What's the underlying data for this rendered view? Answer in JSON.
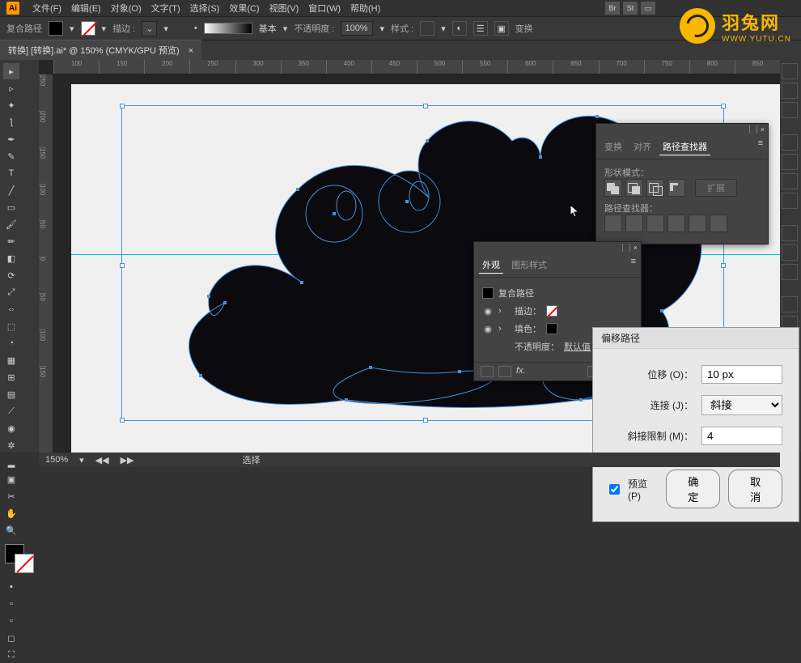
{
  "menu": {
    "items": [
      "文件(F)",
      "编辑(E)",
      "对象(O)",
      "文字(T)",
      "选择(S)",
      "效果(C)",
      "视图(V)",
      "窗口(W)",
      "帮助(H)"
    ],
    "right_icons": [
      "Br",
      "St"
    ]
  },
  "controlbar": {
    "label": "复合路径",
    "stroke_label": "描边 :",
    "stroke_dropdown": "",
    "preset_label": "基本",
    "opacity_label": "不透明度 :",
    "opacity_value": "100%",
    "style_label": "样式 :",
    "transform_label": "变换"
  },
  "document": {
    "tab_title": "转换] [转换].ai* @ 150% (CMYK/GPU 预览)"
  },
  "ruler": {
    "h_ticks": [
      "100",
      "150",
      "200",
      "250",
      "300",
      "350",
      "400",
      "450",
      "500",
      "550",
      "600",
      "650",
      "700",
      "750",
      "800",
      "850"
    ],
    "v_ticks": [
      "250",
      "200",
      "150",
      "100",
      "50",
      "0",
      "50",
      "100",
      "150"
    ]
  },
  "pathfinder_panel": {
    "tab_transform": "变换",
    "tab_align": "对齐",
    "tab_pathfinder": "路径查找器",
    "shape_modes_label": "形状模式：",
    "expand_label": "扩展",
    "pathfinders_label": "路径查找器："
  },
  "appearance_panel": {
    "tab_appearance": "外观",
    "tab_graphic_styles": "图形样式",
    "item_title": "复合路径",
    "stroke_label": "描边：",
    "fill_label": "填色：",
    "opacity_label": "不透明度：",
    "opacity_value": "默认值",
    "fx_label": "fx."
  },
  "offset_dialog": {
    "title": "偏移路径",
    "offset_label": "位移 (O)：",
    "offset_value": "10 px",
    "join_label": "连接 (J)：",
    "join_value": "斜接",
    "miter_label": "斜接限制 (M)：",
    "miter_value": "4",
    "preview_label": "预览 (P)",
    "ok_label": "确定",
    "cancel_label": "取消"
  },
  "statusbar": {
    "zoom": "150%",
    "tool": "选择"
  },
  "watermark": {
    "cn": "羽兔网",
    "en": "WWW.YUTU.CN"
  },
  "tools": [
    "select",
    "direct-select",
    "magic-wand",
    "lasso",
    "pen",
    "curvature",
    "type",
    "line",
    "rectangle",
    "brush",
    "pencil",
    "eraser",
    "rotate",
    "scale",
    "width",
    "free-transform",
    "shape-builder",
    "perspective",
    "mesh",
    "gradient",
    "eyedropper",
    "blend",
    "symbol-sprayer",
    "graph",
    "artboard",
    "slice",
    "hand",
    "zoom"
  ]
}
